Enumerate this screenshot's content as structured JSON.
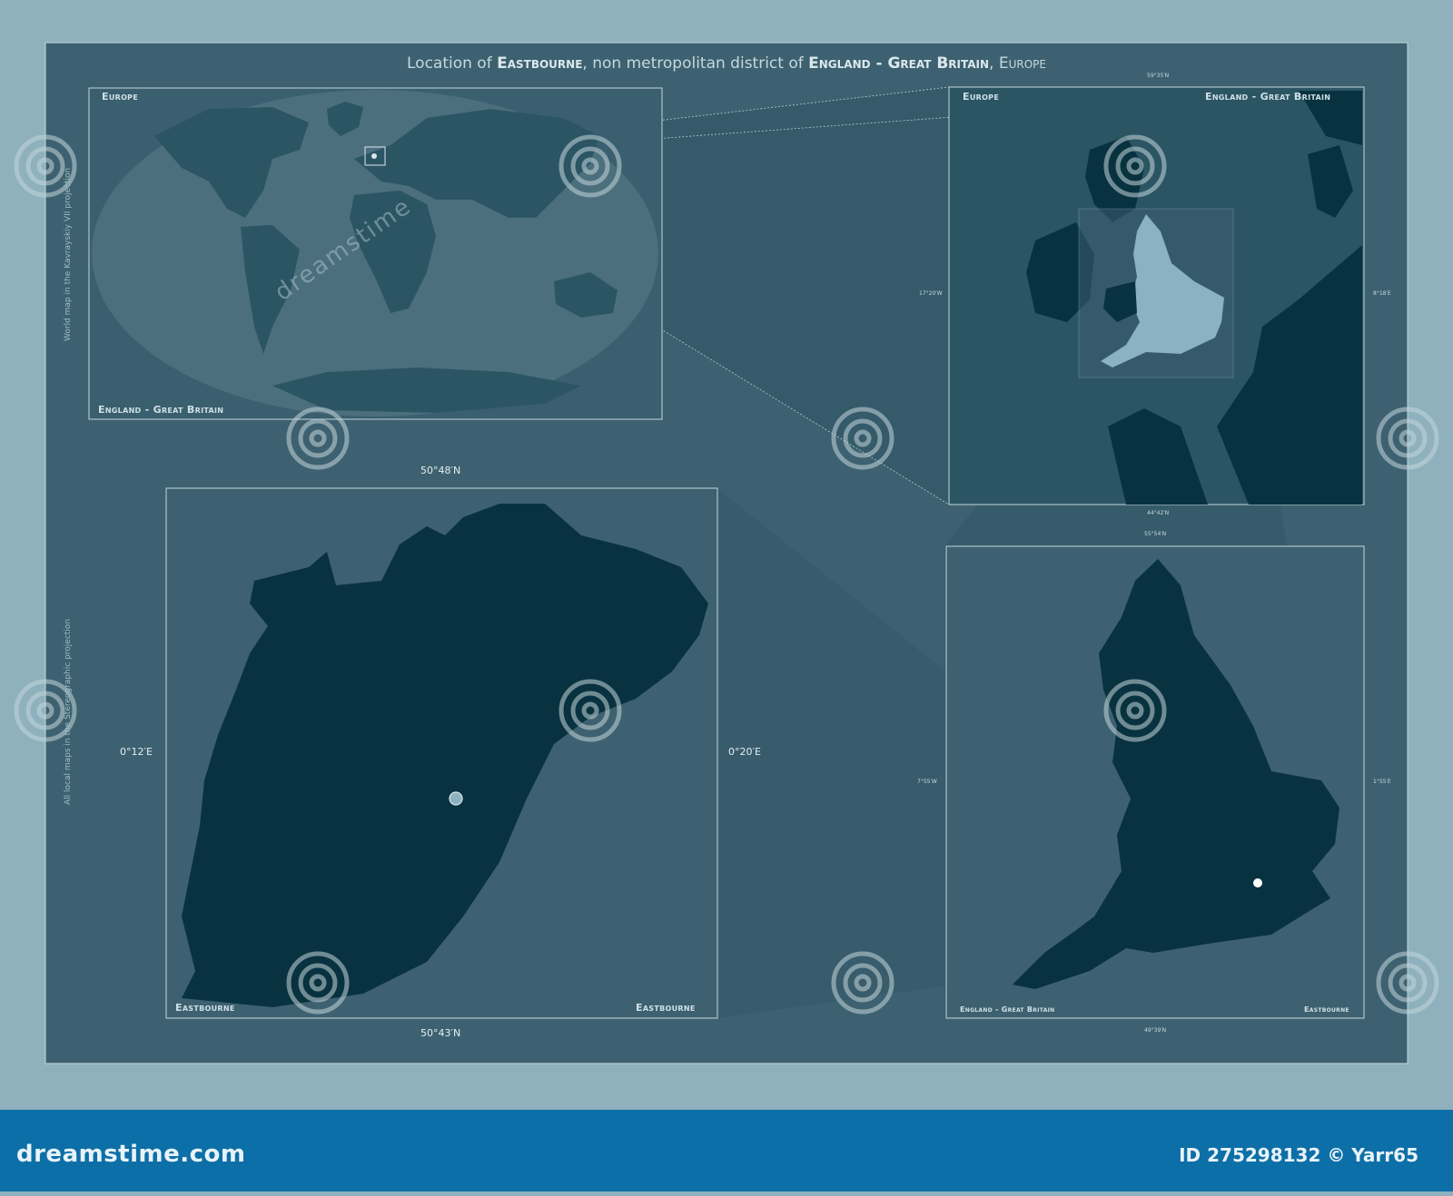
{
  "title": {
    "prefix": "Location of ",
    "place": "Eastbourne",
    "mid": ", non metropolitan district of ",
    "country": "England - Great Britain",
    "sep": ", ",
    "region": "Europe"
  },
  "panels": {
    "world": {
      "label_top": "Europe",
      "label_bottom": "England - Great Britain"
    },
    "europe": {
      "label_left": "Europe",
      "label_right": "England - Great Britain",
      "lat_top": "59°35′N",
      "lat_bottom": "44°42′N",
      "lon_left": "17°20′W",
      "lon_right": "8°18′E"
    },
    "england": {
      "label_left": "England - Great Britain",
      "label_right": "Eastbourne",
      "lat_top": "55°54′N",
      "lat_bottom": "49°39′N",
      "lon_left": "7°55′W",
      "lon_right": "1°55′E"
    },
    "district": {
      "label_left": "Eastbourne",
      "label_right": "Eastbourne",
      "lat_top": "50°48′N",
      "lat_bottom": "50°43′N",
      "lon_left": "0°12′E",
      "lon_right": "0°20′E"
    }
  },
  "side_notes": {
    "world": "World map in the Kavrayskiy VII projection",
    "local": "All local maps in the Stereographic projection"
  },
  "watermark": {
    "text": "dreamstime"
  },
  "footer": {
    "site": "dreamstime.com",
    "id": "ID 275298132 © Yarr65"
  },
  "colors": {
    "outer": "#8eb1bd",
    "inner": "#3d6170",
    "land_dark": "#093240",
    "land_mid": "#2c5564",
    "highlight": "#8ab2c0",
    "footer": "#0d6fa7"
  }
}
